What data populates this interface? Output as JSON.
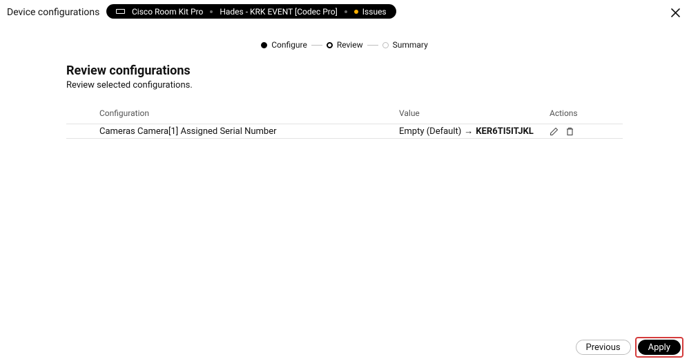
{
  "header": {
    "title": "Device configurations",
    "device_name": "Cisco Room Kit Pro",
    "device_location": "Hades - KRK EVENT [Codec Pro]",
    "issues_label": "Issues"
  },
  "stepper": {
    "steps": [
      {
        "label": "Configure",
        "state": "done"
      },
      {
        "label": "Review",
        "state": "current"
      },
      {
        "label": "Summary",
        "state": "upcoming"
      }
    ]
  },
  "main": {
    "title": "Review configurations",
    "subtitle": "Review selected configurations."
  },
  "table": {
    "headers": {
      "config": "Configuration",
      "value": "Value",
      "actions": "Actions"
    },
    "rows": [
      {
        "config": "Cameras Camera[1] Assigned Serial Number",
        "value_old": "Empty (Default)",
        "value_arrow": "→",
        "value_new": "KER6TI5ITJKL"
      }
    ]
  },
  "footer": {
    "previous": "Previous",
    "apply": "Apply"
  }
}
